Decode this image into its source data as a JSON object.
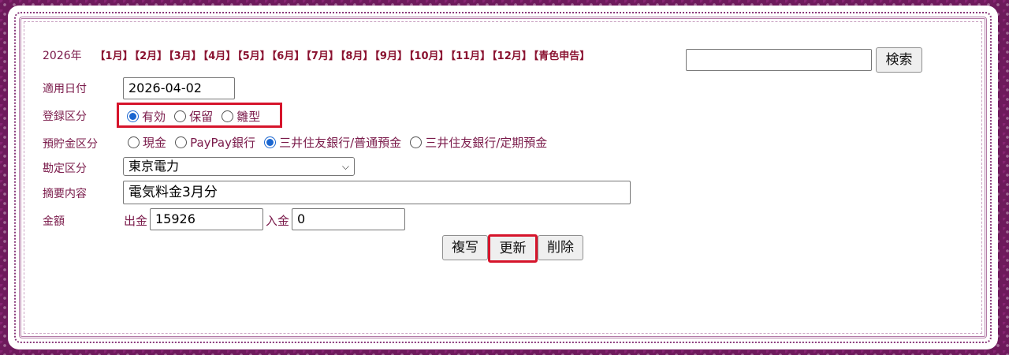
{
  "header": {
    "year": "2026年",
    "months": [
      "【1月】",
      "【2月】",
      "【3月】",
      "【4月】",
      "【5月】",
      "【6月】",
      "【7月】",
      "【8月】",
      "【9月】",
      "【10月】",
      "【11月】",
      "【12月】",
      "【青色申告】"
    ],
    "search_button": "検索",
    "search_value": ""
  },
  "form": {
    "date_label": "適用日付",
    "date_value": "2026-04-02",
    "status_label": "登録区分",
    "status_options": [
      "有効",
      "保留",
      "雛型"
    ],
    "status_selected": "有効",
    "account_label": "預貯金区分",
    "account_options": [
      "現金",
      "PayPay銀行",
      "三井住友銀行/普通預金",
      "三井住友銀行/定期預金"
    ],
    "account_selected": "三井住友銀行/普通預金",
    "category_label": "勘定区分",
    "category_value": "東京電力",
    "memo_label": "摘要内容",
    "memo_value": "電気料金3月分",
    "amount_label": "金額",
    "outflow_label": "出金",
    "outflow_value": "15926",
    "inflow_label": "入金",
    "inflow_value": "0"
  },
  "actions": {
    "copy": "複写",
    "update": "更新",
    "delete": "削除"
  },
  "colors": {
    "background": "#6e1a5c",
    "label_text": "#7a1a4a",
    "month_link": "#8a1230",
    "highlight_border": "#d6142b",
    "radio_checked": "#1a66d0"
  }
}
